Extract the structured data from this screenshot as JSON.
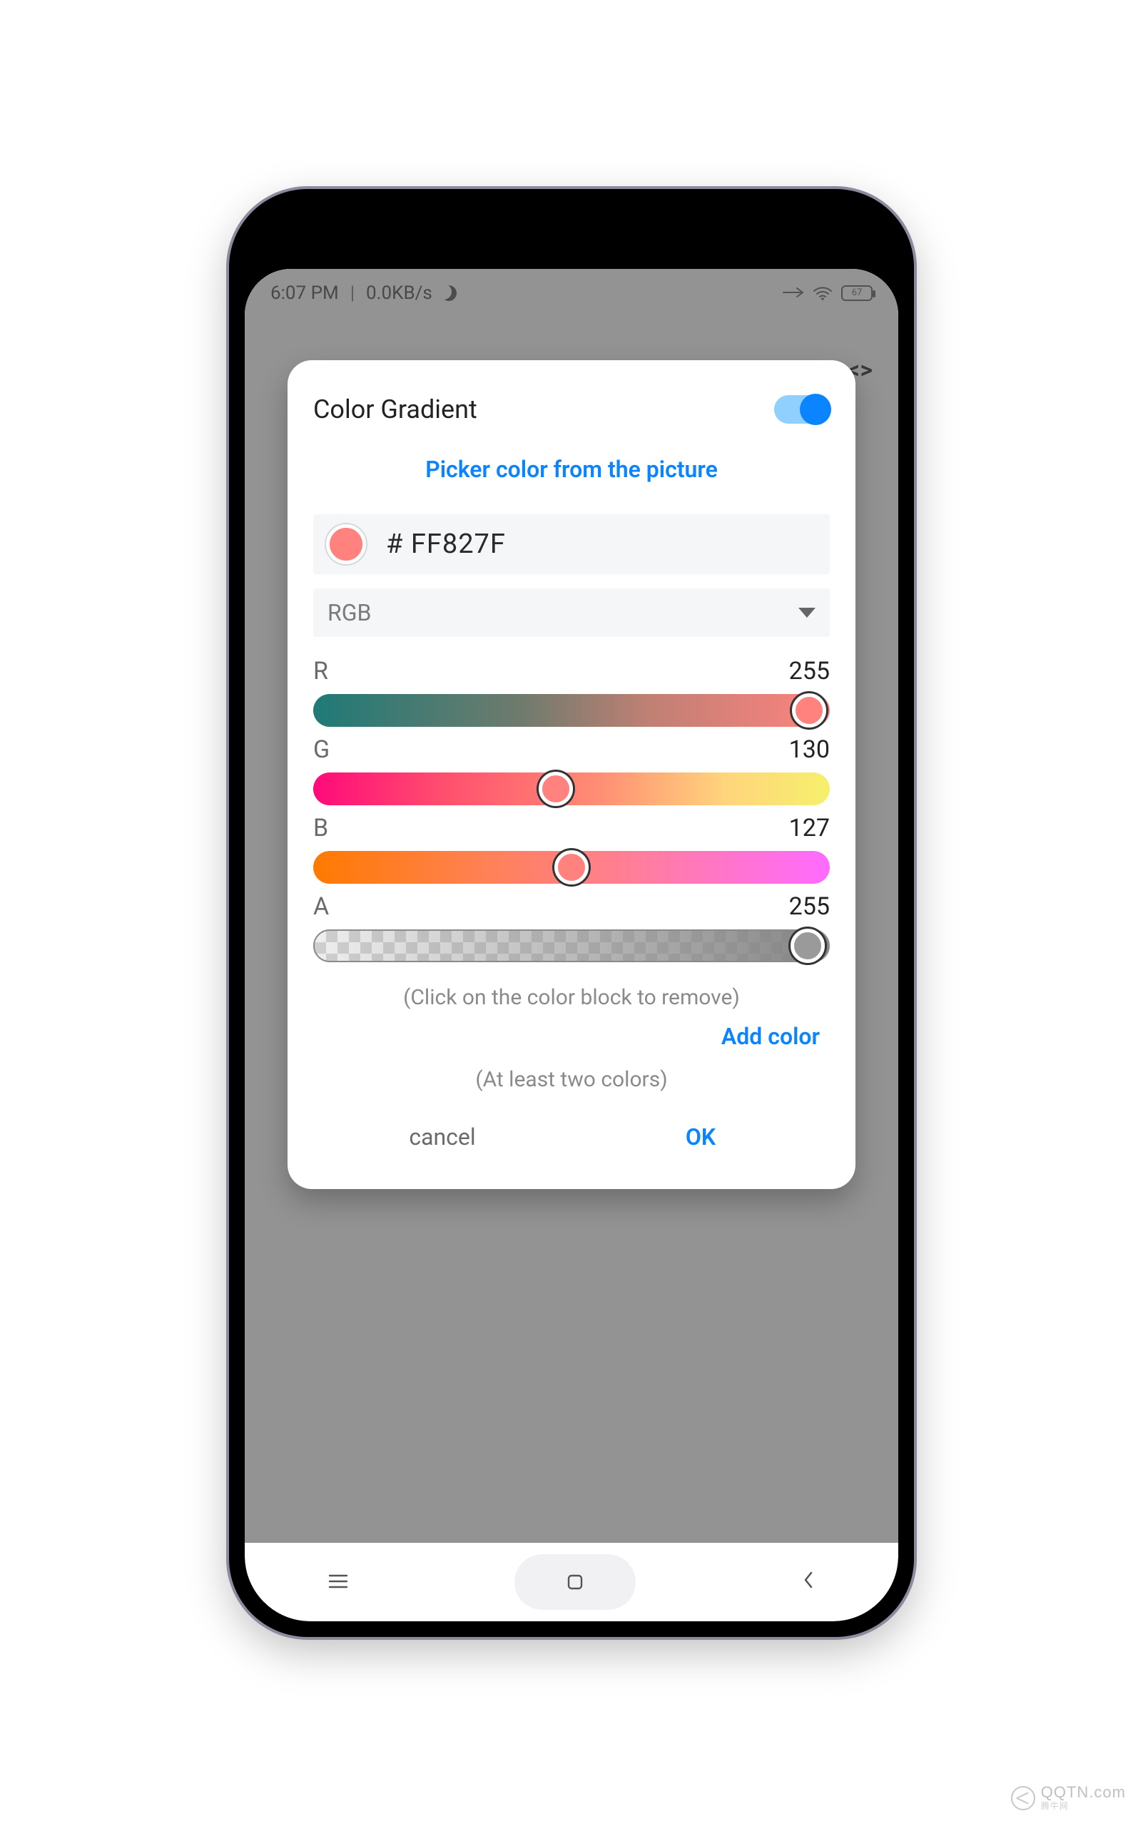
{
  "status": {
    "time": "6:07 PM",
    "net_speed": "0.0KB/s",
    "battery_text": "67"
  },
  "background": {
    "code_icon": "< >"
  },
  "dialog": {
    "title": "Color Gradient",
    "toggle_on": true,
    "picker_link": "Picker color from the picture",
    "hex": "# FF827F",
    "mode_label": "RGB",
    "channels": {
      "r": {
        "label": "R",
        "value": "255",
        "pos_pct": 96
      },
      "g": {
        "label": "G",
        "value": "130",
        "pos_pct": 47
      },
      "b": {
        "label": "B",
        "value": "127",
        "pos_pct": 50
      },
      "a": {
        "label": "A",
        "value": "255",
        "pos_pct": 96
      }
    },
    "hint_remove": "(Click on the color block to remove)",
    "add_color": "Add color",
    "hint_min": "(At least two colors)",
    "cancel": "cancel",
    "ok": "OK"
  },
  "colors": {
    "accent": "#0a84ff",
    "swatch": "#ff827f"
  },
  "watermark": {
    "brand": "QQTN",
    "sub": "腾牛网",
    "suffix": ".com"
  }
}
